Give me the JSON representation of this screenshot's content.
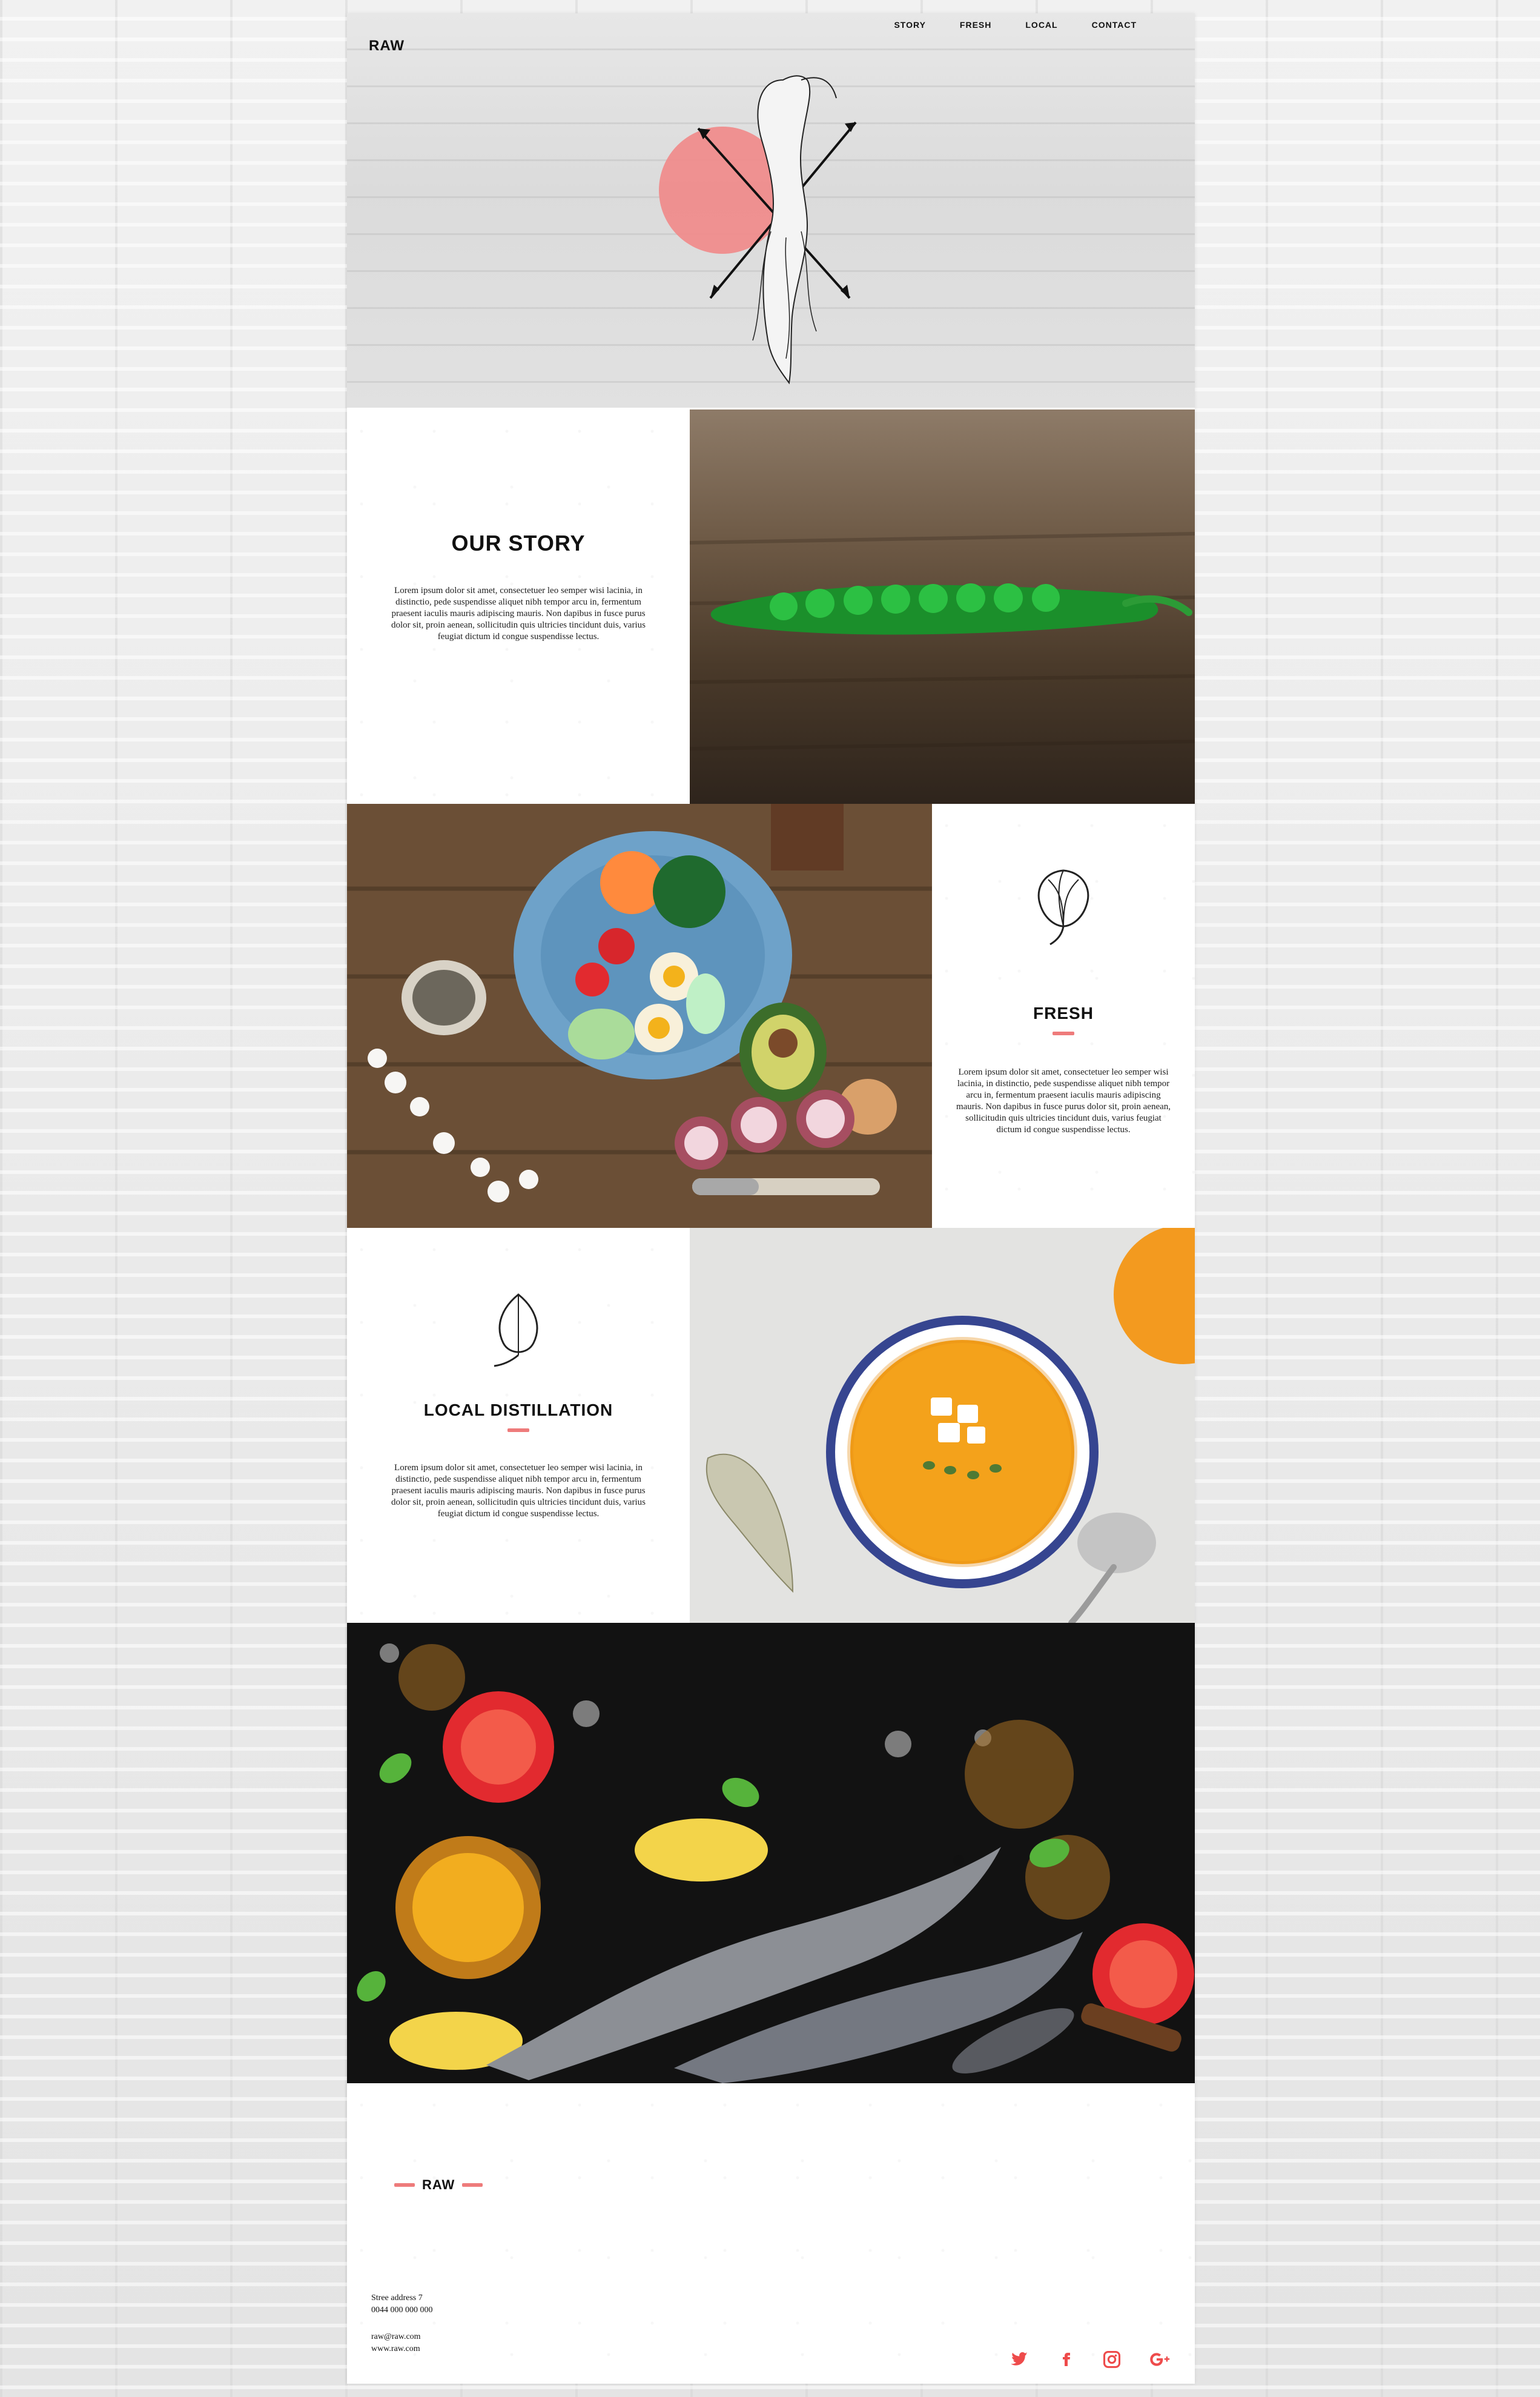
{
  "brand": {
    "logo": "RAW"
  },
  "nav": [
    {
      "label": "STORY"
    },
    {
      "label": "FRESH"
    },
    {
      "label": "LOCAL"
    },
    {
      "label": "CONTACT"
    }
  ],
  "story": {
    "title": "OUR STORY",
    "body": "Lorem ipsum dolor sit amet, consectetuer leo semper wisi lacinia, in distinctio, pede suspendisse aliquet nibh tempor arcu in, fermentum praesent iaculis mauris adipiscing mauris. Non dapibus in fusce purus dolor sit, proin aenean, sollicitudin quis ultricies tincidunt duis, varius feugiat dictum id congue suspendisse lectus."
  },
  "fresh": {
    "title": "FRESH",
    "body": "Lorem ipsum dolor sit amet, consectetuer leo semper wisi lacinia, in distinctio, pede suspendisse aliquet nibh tempor arcu in, fermentum praesent iaculis mauris adipiscing mauris. Non dapibus in fusce purus dolor sit, proin aenean, sollicitudin quis ultricies tincidunt duis, varius feugiat dictum id congue suspendisse lectus."
  },
  "local": {
    "title": "LOCAL DISTILLATION",
    "body": "Lorem ipsum dolor sit amet, consectetuer leo semper wisi lacinia, in distinctio, pede suspendisse aliquet nibh tempor arcu in, fermentum praesent iaculis mauris adipiscing mauris. Non dapibus in fusce purus dolor sit, proin aenean, sollicitudin quis ultricies tincidunt duis, varius feugiat dictum id congue suspendisse lectus."
  },
  "footer": {
    "logo": "RAW",
    "address": "Stree address 7",
    "phone": "0044 000 000 000",
    "email": "raw@raw.com",
    "website": "www.raw.com"
  },
  "social": [
    {
      "icon": "twitter-icon"
    },
    {
      "icon": "facebook-icon"
    },
    {
      "icon": "instagram-icon"
    },
    {
      "icon": "google-plus-icon"
    }
  ],
  "colors": {
    "accent": "#ee7b7b",
    "text": "#111111",
    "background": "#ffffff"
  }
}
